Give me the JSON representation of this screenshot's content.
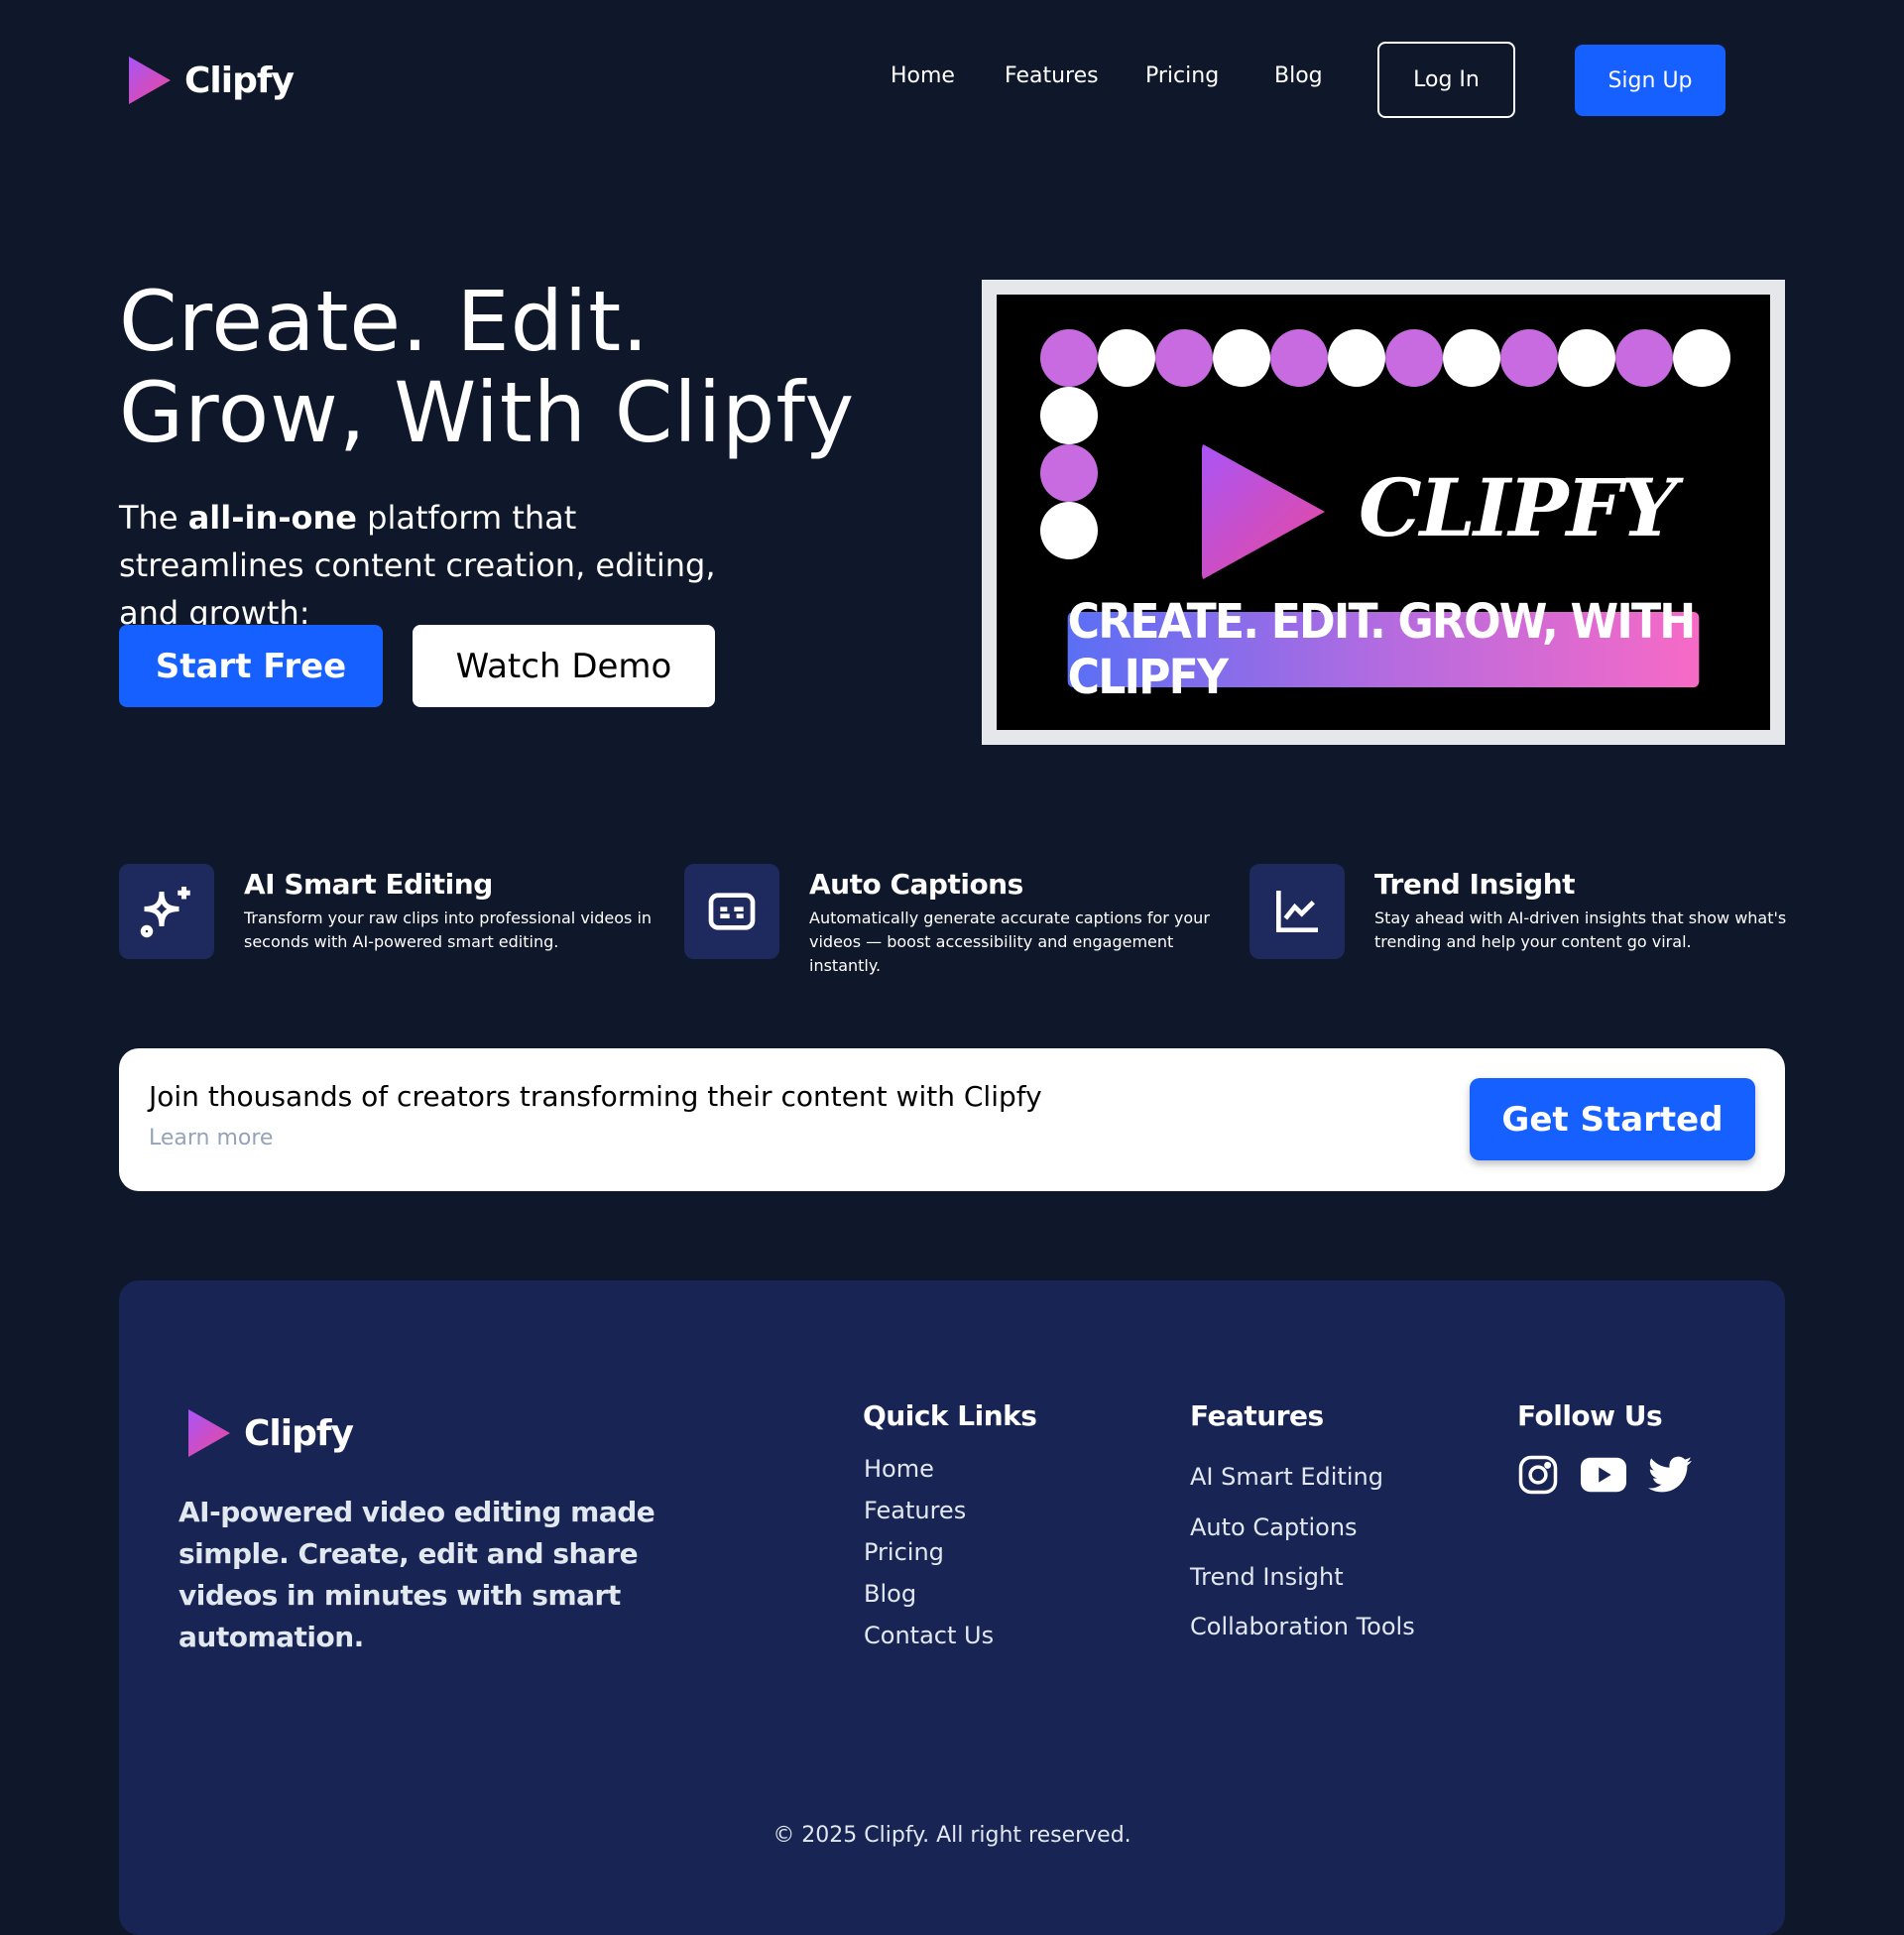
{
  "brand": {
    "name": "Clipfy"
  },
  "nav": {
    "items": [
      "Home",
      "Features",
      "Pricing",
      "Blog"
    ],
    "login": "Log In",
    "signup": "Sign Up"
  },
  "hero": {
    "title_line1": "Create. Edit.",
    "title_line2": "Grow, With Clipfy",
    "subtitle_pre": "The ",
    "subtitle_bold": "all-in-one",
    "subtitle_post": " platform that streamlines content creation, editing, and growth:",
    "start_free": "Start Free",
    "watch_demo": "Watch Demo",
    "image": {
      "wordmark": "CLIPFY",
      "tagline": "CREATE. EDIT. GROW, WITH CLIPFY"
    }
  },
  "features": [
    {
      "icon": "sparkles-icon",
      "title": "AI Smart Editing",
      "desc": "Transform your raw clips into professional videos in seconds with AI-powered smart editing."
    },
    {
      "icon": "captions-icon",
      "title": "Auto Captions",
      "desc": "Automatically generate accurate captions for your videos — boost accessibility and engagement instantly."
    },
    {
      "icon": "chart-line-icon",
      "title": "Trend Insight",
      "desc": "Stay ahead with AI-driven insights that show what's trending and help your content go viral."
    }
  ],
  "cta": {
    "text": "Join thousands of creators transforming their content with Clipfy",
    "link": "Learn more",
    "button": "Get Started"
  },
  "footer": {
    "description": "AI-powered video editing made simple. Create, edit and share videos in minutes with smart automation.",
    "quick_links": {
      "title": "Quick Links",
      "items": [
        "Home",
        "Features",
        "Pricing",
        "Blog",
        "Contact Us"
      ]
    },
    "features": {
      "title": "Features",
      "items": [
        "AI Smart Editing",
        "Auto Captions",
        "Trend Insight",
        "Collaboration Tools"
      ]
    },
    "follow": {
      "title": "Follow Us",
      "icons": [
        "instagram-icon",
        "youtube-icon",
        "twitter-icon"
      ]
    },
    "copyright": "© 2025 Clipfy. All right reserved."
  },
  "colors": {
    "bg": "#0f172a",
    "accent": "#1560ff",
    "footer": "#182454",
    "purple": "#c86ae0"
  }
}
